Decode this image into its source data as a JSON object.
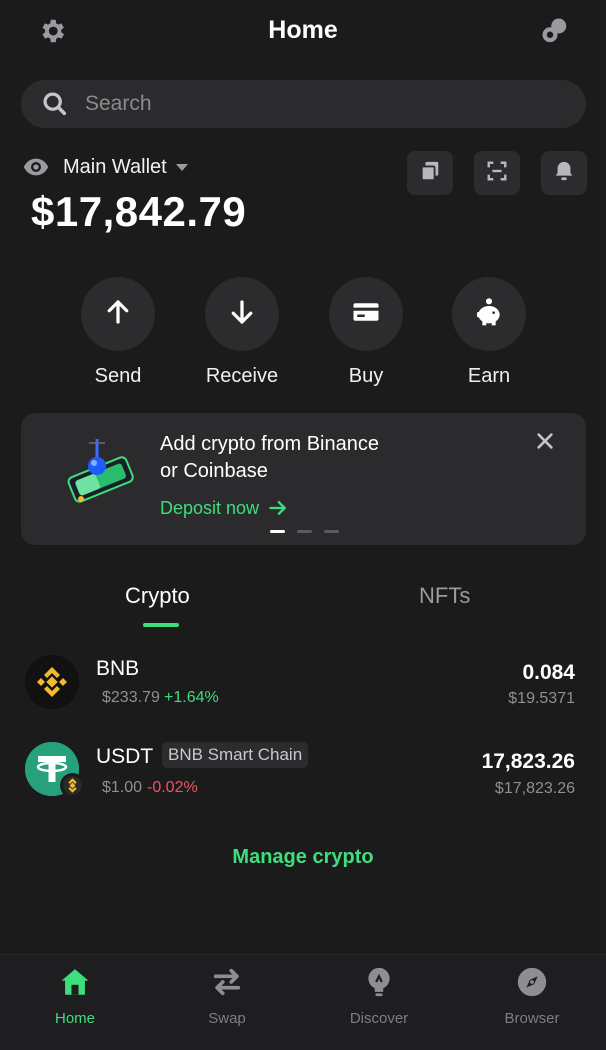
{
  "header": {
    "title": "Home",
    "left_icon": "gear-icon",
    "right_icon": "link-circles-icon"
  },
  "search": {
    "placeholder": "Search"
  },
  "wallet": {
    "name": "Main Wallet",
    "balance": "$17,842.79",
    "action_icons": [
      "copy-icon",
      "scan-icon",
      "bell-icon"
    ]
  },
  "quick_actions": [
    {
      "label": "Send",
      "icon": "arrow-up-icon"
    },
    {
      "label": "Receive",
      "icon": "arrow-down-icon"
    },
    {
      "label": "Buy",
      "icon": "card-icon"
    },
    {
      "label": "Earn",
      "icon": "piggy-bank-icon"
    }
  ],
  "promo": {
    "line1": "Add crypto from Binance",
    "line2": "or Coinbase",
    "cta": "Deposit now"
  },
  "tabs": [
    {
      "label": "Crypto",
      "active": true
    },
    {
      "label": "NFTs",
      "active": false
    }
  ],
  "assets": [
    {
      "symbol": "BNB",
      "price": "$233.79",
      "change": "+1.64%",
      "amount": "0.084",
      "value": "$19.5371"
    },
    {
      "symbol": "USDT",
      "chain": "BNB Smart Chain",
      "price": "$1.00",
      "change": "-0.02%",
      "amount": "17,823.26",
      "value": "$17,823.26"
    }
  ],
  "manage_label": "Manage crypto",
  "bottom_nav": [
    {
      "label": "Home",
      "active": true
    },
    {
      "label": "Swap",
      "active": false
    },
    {
      "label": "Discover",
      "active": false
    },
    {
      "label": "Browser",
      "active": false
    }
  ],
  "colors": {
    "accent": "#3dde7c",
    "negative": "#f0545f",
    "background": "#1b1b1c",
    "card": "#2b2b2d"
  }
}
